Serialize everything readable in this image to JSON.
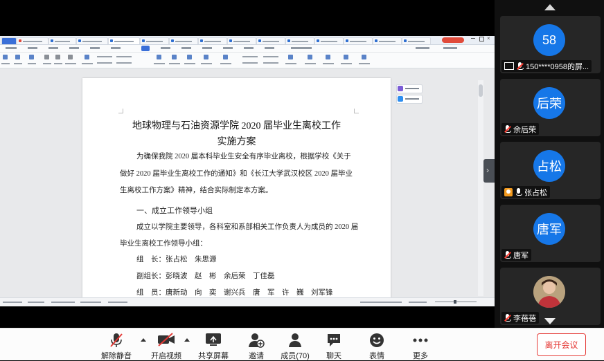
{
  "document": {
    "title_line1": "地球物理与石油资源学院 2020 届毕业生离校工作",
    "title_line2": "实施方案",
    "paragraphs": [
      "为确保我院 2020 届本科毕业生安全有序毕业离校，根据学校《关于",
      "做好 2020 届毕业生离校工作的通知》和《长江大学武汉校区 2020 届毕业",
      "生离校工作方案》精神，结合实际制定本方案。"
    ],
    "section1_heading": "一、成立工作领导小组",
    "section1_paras": [
      "成立以学院主要领导，各科室和系部相关工作负责人为成员的 2020 届",
      "毕业生离校工作领导小组："
    ],
    "roles": [
      "组　长：张占松　朱思源",
      "副组长：彭晓波　赵　彬　余后荣　丁佳磊",
      "组　员：唐新动　向　奕　谢兴兵　唐　军　许　巍　刘军锋"
    ]
  },
  "participants": [
    {
      "avatar_text": "58",
      "name": "150****0958的屏...",
      "kind": "avatar",
      "badge": "screen-share-icon",
      "muted": true
    },
    {
      "avatar_text": "后荣",
      "name": "余后荣",
      "kind": "avatar",
      "badge": "none",
      "muted": true
    },
    {
      "avatar_text": "占松",
      "name": "张占松",
      "kind": "avatar",
      "badge": "host-icon",
      "muted": false
    },
    {
      "avatar_text": "唐军",
      "name": "唐军",
      "kind": "avatar",
      "badge": "none",
      "muted": true
    },
    {
      "avatar_text": "",
      "name": "李蓓蓓",
      "kind": "photo",
      "badge": "none",
      "muted": true
    }
  ],
  "toolbar": {
    "unmute": "解除静音",
    "video": "开启视频",
    "share": "共享屏幕",
    "invite": "邀请",
    "members": "成员(70)",
    "chat": "聊天",
    "reactions": "表情",
    "more": "更多",
    "leave": "离开会议"
  },
  "colors": {
    "avatar_blue": "#1677e8",
    "leave_red": "#e53935",
    "mute_red": "#ff3b30",
    "host_orange": "#f39a1e"
  }
}
